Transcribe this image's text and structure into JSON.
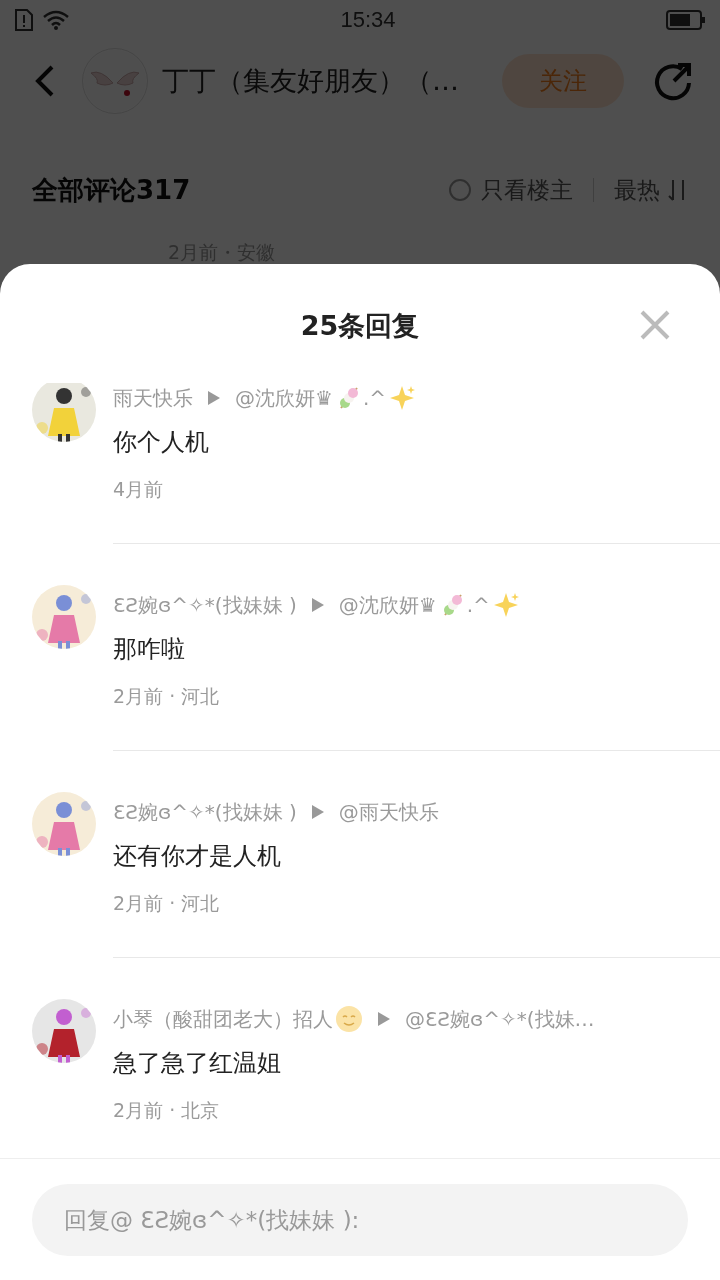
{
  "status_bar": {
    "time": "15:34"
  },
  "background": {
    "title": "丁丁（集友好朋友）（…",
    "follow_button": "关注",
    "comments_title": "全部评论317",
    "owner_only": {
      "label": "只看楼主",
      "checked": false
    },
    "sort": "最热",
    "partial_meta": "2月前・安徽"
  },
  "sheet": {
    "title": "25条回复",
    "replies": [
      {
        "author_parts": [
          {
            "kind": "text",
            "text": "雨天快乐"
          }
        ],
        "target_parts": [
          {
            "kind": "text",
            "text": "@沈欣妍♛"
          },
          {
            "kind": "dango"
          },
          {
            "kind": "text",
            "text": ".^"
          },
          {
            "kind": "sparkle"
          }
        ],
        "content": "你个人机",
        "meta": "4月前"
      },
      {
        "author_parts": [
          {
            "kind": "text",
            "text": "ƐƧ婉ɞ^✧*(找妹妹 )"
          }
        ],
        "target_parts": [
          {
            "kind": "text",
            "text": "@沈欣妍♛"
          },
          {
            "kind": "dango"
          },
          {
            "kind": "text",
            "text": ".^"
          },
          {
            "kind": "sparkle"
          }
        ],
        "content": "那咋啦",
        "meta": "2月前 · 河北"
      },
      {
        "author_parts": [
          {
            "kind": "text",
            "text": "ƐƧ婉ɞ^✧*(找妹妹 )"
          }
        ],
        "target_parts": [
          {
            "kind": "text",
            "text": "@雨天快乐"
          }
        ],
        "content": "还有你才是人机",
        "meta": "2月前 · 河北"
      },
      {
        "author_parts": [
          {
            "kind": "text",
            "text": "小琴（酸甜团老大）招人"
          },
          {
            "kind": "smile"
          }
        ],
        "target_parts": [
          {
            "kind": "text",
            "text": "@ƐƧ婉ɞ^✧*(找妹…"
          }
        ],
        "content": "急了急了红温姐",
        "meta": "2月前 · 北京"
      }
    ],
    "reply_field": {
      "placeholder": "回复@ ƐƧ婉ɞ^✧*(找妹妹 ):"
    }
  }
}
